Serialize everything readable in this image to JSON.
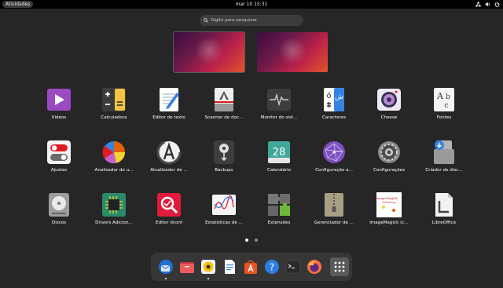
{
  "topbar": {
    "activities": "Atividades",
    "clock": "mar 10  15:31"
  },
  "search": {
    "placeholder": "Digite para pesquisar"
  },
  "apps": [
    {
      "label": "Vídeos"
    },
    {
      "label": "Calculadora"
    },
    {
      "label": "Editor de texto"
    },
    {
      "label": "Scanner de doc..."
    },
    {
      "label": "Monitor do sist..."
    },
    {
      "label": "Caracteres"
    },
    {
      "label": "Cheese"
    },
    {
      "label": "Fontes"
    },
    {
      "label": "Ajustes"
    },
    {
      "label": "Analisador de u..."
    },
    {
      "label": "Atualizador de ..."
    },
    {
      "label": "Backups"
    },
    {
      "label": "Calendário"
    },
    {
      "label": "Configuração a..."
    },
    {
      "label": "Configurações"
    },
    {
      "label": "Criador de disc..."
    },
    {
      "label": "Discos"
    },
    {
      "label": "Drivers Adicion..."
    },
    {
      "label": "Editor dconf"
    },
    {
      "label": "Estatísticas de ..."
    },
    {
      "label": "Extensões"
    },
    {
      "label": "Gerenciador de ..."
    },
    {
      "label": "ImageMagick (c..."
    },
    {
      "label": "LibreOffice"
    }
  ],
  "icons": {
    "calendar_day": "28",
    "fonts_glyphs": "A b c",
    "chars_latin": "ö",
    "chars_arabic": "ش",
    "imagemagick_text": "ImageMagick"
  },
  "dock": [
    "thunderbird",
    "files",
    "rhythmbox",
    "writer",
    "app-center",
    "help",
    "terminal",
    "firefox",
    "show-apps"
  ],
  "colors": {
    "background": "#262626",
    "topbar": "#000000",
    "dock": "#363636"
  }
}
